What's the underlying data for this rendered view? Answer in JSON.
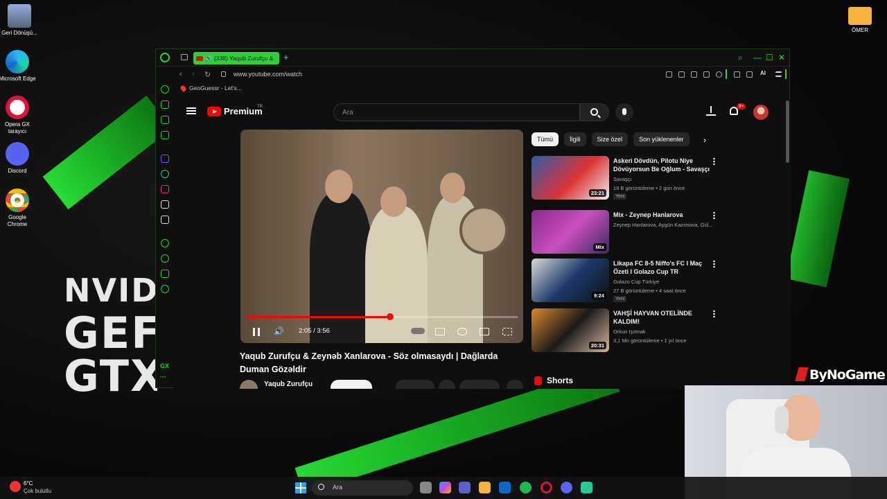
{
  "desktop": {
    "icons": [
      {
        "label": "Geri Dönüşü..."
      },
      {
        "label": "Microsoft Edge"
      },
      {
        "label": "Opera GX tarayıcı"
      },
      {
        "label": "Discord"
      },
      {
        "label": "Google Chrome"
      },
      {
        "label": "ÖMER"
      }
    ],
    "wallpaper_text": [
      "NVIDI",
      "GEF",
      "GTX"
    ]
  },
  "browser": {
    "tab_title": "(338) Yaqub Zurufçu &",
    "new_tab": "+",
    "url": "www.youtube.com/watch",
    "ai_label": "AI",
    "bookmark": "GeoGuessr - Let's...",
    "sidebar_label": "GX",
    "accent_color": "#2cd13a"
  },
  "youtube": {
    "logo_text": "Premium",
    "logo_region": "TR",
    "search_placeholder": "Ara",
    "notifications": "9+",
    "player": {
      "time": "2:05 / 3:56",
      "progress": 0.53
    },
    "video_title": "Yaqub Zurufçu & Zeynəb Xanlarova - Söz olmasaydı | Dağlarda Duman Gözəldir",
    "channel_name": "Yaqub Zurufçu",
    "chips": [
      "Tümü",
      "İlgili",
      "Size özel",
      "Son yüklenenler"
    ],
    "recommendations": [
      {
        "title": "Askeri Dövdün, Pilotu Niye Dövüyorsun Be Oğlum - Savaşçı",
        "channel": "Savaşçı",
        "views": "19 B görüntüleme • 2 gün önce",
        "badge": "Yeni",
        "duration": "23:21"
      },
      {
        "title": "Mix - Zeynep Hanlarova",
        "channel": "Zeynep Hanlarova, Aygün Kazımova, Gül...",
        "views": "",
        "badge": "",
        "duration": "Mix"
      },
      {
        "title": "Likapa FC 8-5 Niffo's FC I Maç Özeti I Golazo Cup TR",
        "channel": "Golazo Cup Türkiye",
        "views": "27 B görüntüleme • 4 saat önce",
        "badge": "Yeni",
        "duration": "9:24"
      },
      {
        "title": "VAHŞİ HAYVAN OTELİNDE KALDIM!",
        "channel": "Orkun Işıtmak",
        "views": "3,1 Mn görüntüleme • 1 yıl önce",
        "badge": "",
        "duration": "20:31"
      }
    ],
    "shorts_label": "Shorts"
  },
  "overlay": {
    "brand": "ByNoGame"
  },
  "taskbar": {
    "temperature": "6°C",
    "condition": "Çok bulutlu",
    "search_placeholder": "Ara"
  }
}
